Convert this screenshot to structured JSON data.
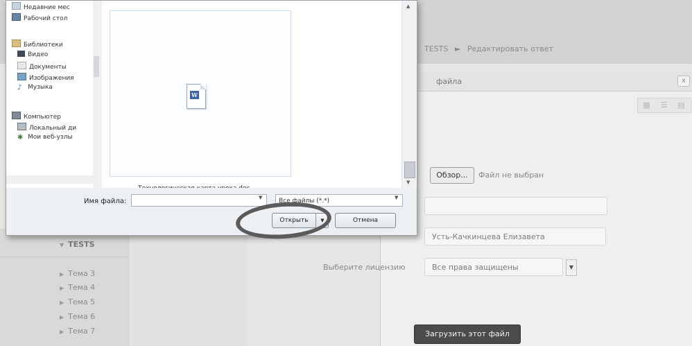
{
  "page": {
    "breadcrumb": [
      "TESTS",
      "►",
      "Редактировать ответ"
    ],
    "modal_title": "файла",
    "modal_close": "x",
    "view_buttons": [
      "▦",
      "☰",
      "▤"
    ],
    "browse_button": "Обзор...",
    "no_file_text": "Файл не выбран",
    "author_value": "Усть-Качкинцева Елизавета",
    "license_label": "Выберите лицензию",
    "license_value": "Все права защищены",
    "upload_button": "Загрузить этот файл",
    "sidebar": {
      "section": "TESTS",
      "items": [
        "Тема 3",
        "Тема 4",
        "Тема 5",
        "Тема 6",
        "Тема 7"
      ]
    }
  },
  "file_dialog": {
    "tree": [
      {
        "label": "Недавние мес",
        "icon": "recent-places-icon"
      },
      {
        "label": "Рабочий стол",
        "icon": "desktop-icon"
      },
      {
        "label": "Библиотеки",
        "icon": "libraries-icon"
      },
      {
        "label": "Видео",
        "icon": "video-icon"
      },
      {
        "label": "Документы",
        "icon": "documents-icon"
      },
      {
        "label": "Изображения",
        "icon": "pictures-icon"
      },
      {
        "label": "Музыка",
        "icon": "music-icon"
      },
      {
        "label": "Компьютер",
        "icon": "computer-icon"
      },
      {
        "label": "Локальный ди",
        "icon": "local-disk-icon"
      },
      {
        "label": "Мои веб-узлы",
        "icon": "web-nodes-icon"
      }
    ],
    "file": {
      "name": "Технологическая карта урока.doc",
      "icon": "word-document-icon"
    },
    "filename_label": "Имя файла:",
    "filename_value": "",
    "filetype_value": "Все файлы (*.*)",
    "open_button": "Открыть",
    "cancel_button": "Отмена"
  },
  "colors": {
    "upload_button_bg": "#4b4b49",
    "annotation_ring": "#5b5b5b"
  }
}
